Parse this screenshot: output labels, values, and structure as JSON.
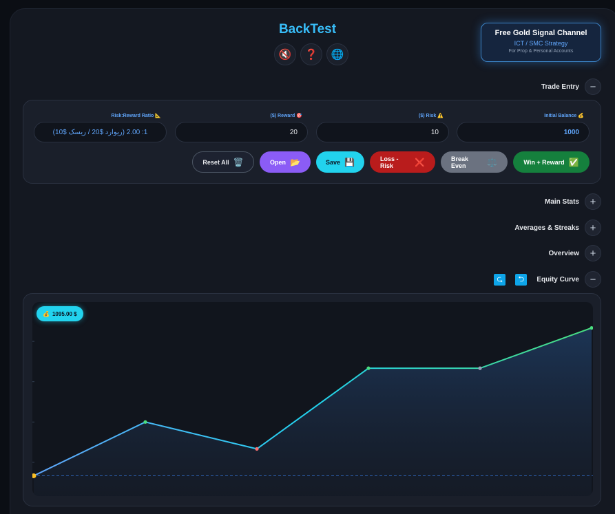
{
  "app": {
    "title": "BackTest"
  },
  "top_icons": [
    {
      "name": "mute-icon",
      "glyph": "🔇"
    },
    {
      "name": "help-icon",
      "glyph": "❓"
    },
    {
      "name": "globe-icon",
      "glyph": "🌐"
    }
  ],
  "promo": {
    "title": "Free Gold Signal Channel",
    "subtitle": "ICT / SMC Strategy",
    "note": "For Prop & Personal Accounts"
  },
  "sections": {
    "trade_entry": "Trade Entry",
    "main_stats": "Main Stats",
    "averages": "Averages & Streaks",
    "overview": "Overview",
    "equity": "Equity Curve"
  },
  "entry": {
    "ratio_label": "Risk:Reward Ratio",
    "ratio_value": "1: 2.00 (ریوارد $20 / ریسک $10)",
    "reward_label": "($) Reward",
    "reward_value": "20",
    "risk_label": "($) Risk",
    "risk_value": "10",
    "balance_label": "Initial Balance",
    "balance_value": "1000"
  },
  "buttons": {
    "reset": "Reset All",
    "open": "Open",
    "save": "Save",
    "loss": "Loss - Risk",
    "breakeven": "Break Even",
    "win": "Win + Reward"
  },
  "badge": {
    "balance": "1095.00 $"
  },
  "colors": {
    "accent": "#38bdf8",
    "win": "#4ade80",
    "loss": "#f87171",
    "start": "#fbbf24"
  },
  "chart_data": {
    "type": "line",
    "x": [
      0,
      1,
      2,
      3,
      4,
      5
    ],
    "values": [
      1000,
      1020,
      1010,
      1040,
      1040,
      1055
    ],
    "point_types": [
      "start",
      "win",
      "loss",
      "win",
      "breakeven",
      "win"
    ],
    "baseline": 1000,
    "ylim": [
      995,
      1060
    ]
  }
}
